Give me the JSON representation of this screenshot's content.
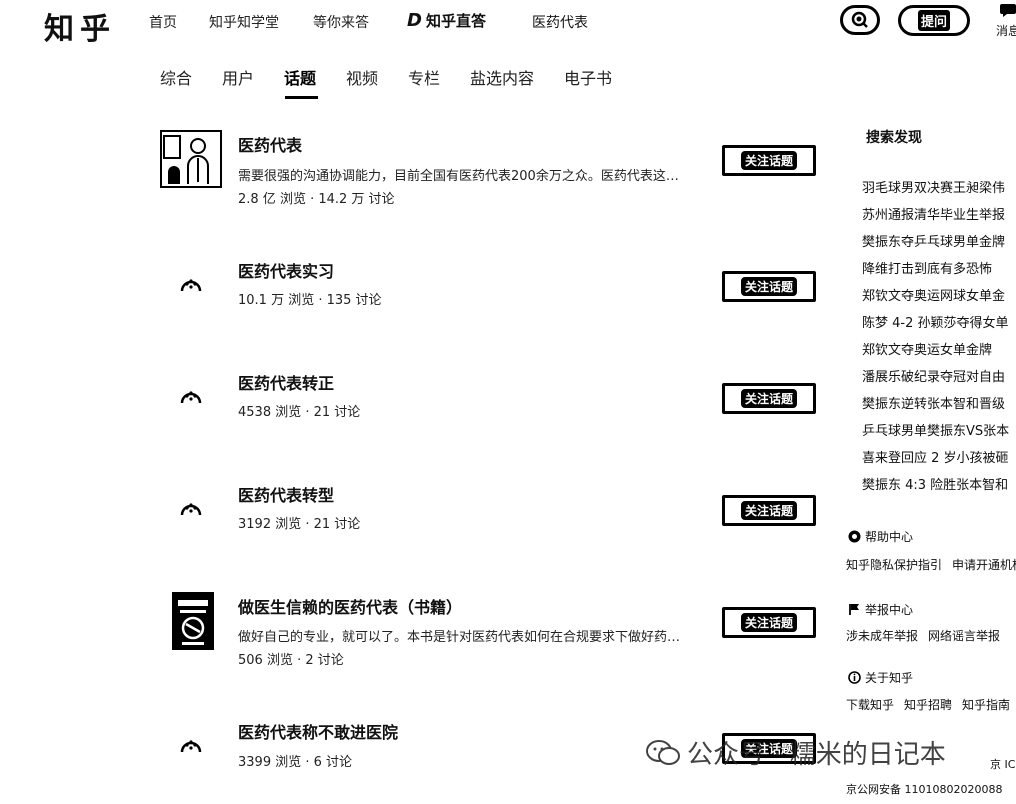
{
  "header": {
    "logo": "知乎",
    "nav": [
      "首页",
      "知乎知学堂",
      "等你来答"
    ],
    "zhida_label": "知乎直答",
    "search_query": "医药代表",
    "ask_label": "提问",
    "messages_label": "消息"
  },
  "tabs": [
    "综合",
    "用户",
    "话题",
    "视频",
    "专栏",
    "盐选内容",
    "电子书"
  ],
  "active_tab": "话题",
  "results": [
    {
      "title": "医药代表",
      "desc": "需要很强的沟通协调能力，目前全国有医药代表200余万之众。医药代表这…",
      "meta": "2.8 亿 浏览 · 14.2 万 讨论",
      "follow": "关注话题"
    },
    {
      "title": "医药代表实习",
      "desc": "",
      "meta": "10.1 万 浏览 · 135 讨论",
      "follow": "关注话题"
    },
    {
      "title": "医药代表转正",
      "desc": "",
      "meta": "4538 浏览 · 21 讨论",
      "follow": "关注话题"
    },
    {
      "title": "医药代表转型",
      "desc": "",
      "meta": "3192 浏览 · 21 讨论",
      "follow": "关注话题"
    },
    {
      "title": "做医生信赖的医药代表（书籍）",
      "desc": "做好自己的专业，就可以了。本书是针对医药代表如何在合规要求下做好药…",
      "meta": "506 浏览 · 2 讨论",
      "follow": "关注话题"
    },
    {
      "title": "医药代表称不敢进医院",
      "desc": "",
      "meta": "3399 浏览 · 6 讨论",
      "follow": "关注话题"
    }
  ],
  "sidebar": {
    "discover_title": "搜索发现",
    "trending": [
      "羽毛球男双决赛王昶梁伟",
      "苏州通报清华毕业生举报",
      "樊振东夺乒乓球男单金牌",
      "降维打击到底有多恐怖",
      "郑钦文夺奥运网球女单金",
      "陈梦 4-2 孙颖莎夺得女单",
      "郑钦文夺奥运女单金牌",
      "潘展乐破纪录夺冠对自由",
      "樊振东逆转张本智和晋级",
      "乒乓球男单樊振东VS张本",
      "喜来登回应 2 岁小孩被砸",
      "樊振东 4:3 险胜张本智和"
    ],
    "help_title": "帮助中心",
    "help_links": [
      "知乎隐私保护指引",
      "申请开通机构号"
    ],
    "report_title": "举报中心",
    "report_links": [
      "涉未成年举报",
      "网络谣言举报"
    ],
    "about_title": "关于知乎",
    "about_links": [
      "下载知乎",
      "知乎招聘",
      "知乎指南"
    ],
    "footer_line1": "京 ICP",
    "footer_line2": "京公网安备 11010802020088"
  },
  "watermark": "公众号 · 糯米的日记本"
}
